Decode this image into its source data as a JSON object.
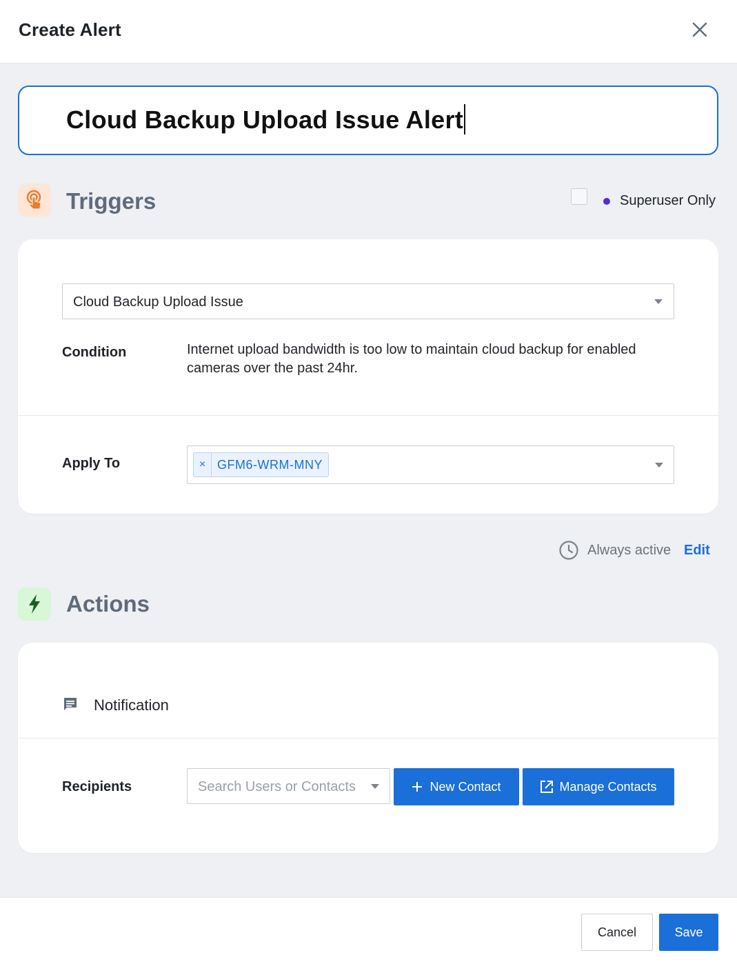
{
  "header": {
    "title": "Create Alert"
  },
  "alert_name": {
    "value": "Cloud Backup Upload Issue Alert"
  },
  "triggers": {
    "title": "Triggers",
    "superuser_label": "Superuser Only",
    "trigger_type": "Cloud Backup Upload Issue",
    "condition_label": "Condition",
    "condition_line1": "Internet upload bandwidth is too low to maintain cloud backup for enabled",
    "condition_line2": "cameras over the past 24hr.",
    "apply_to_label": "Apply To",
    "apply_to_tag_remove": "×",
    "apply_to_tag": "GFM6-WRM-MNY"
  },
  "schedule": {
    "status": "Always active",
    "edit_label": "Edit"
  },
  "actions": {
    "title": "Actions",
    "notification_label": "Notification",
    "recipients_label": "Recipients",
    "search_placeholder": "Search Users or Contacts",
    "new_contact_label": "New Contact",
    "manage_contacts_label": "Manage Contacts"
  },
  "footer": {
    "cancel_label": "Cancel",
    "save_label": "Save"
  },
  "colors": {
    "accent": "#1a6fd8",
    "triggers_icon": "#f07a2a",
    "actions_icon": "#1eb82e",
    "superuser_dot": "#5b2bd6"
  },
  "icons": {
    "close": "close-icon",
    "triggers": "touch-hand-icon",
    "actions": "lightning-bolt-icon",
    "clock": "clock-icon",
    "notification": "message-icon",
    "plus": "plus-icon",
    "external": "external-link-icon"
  }
}
